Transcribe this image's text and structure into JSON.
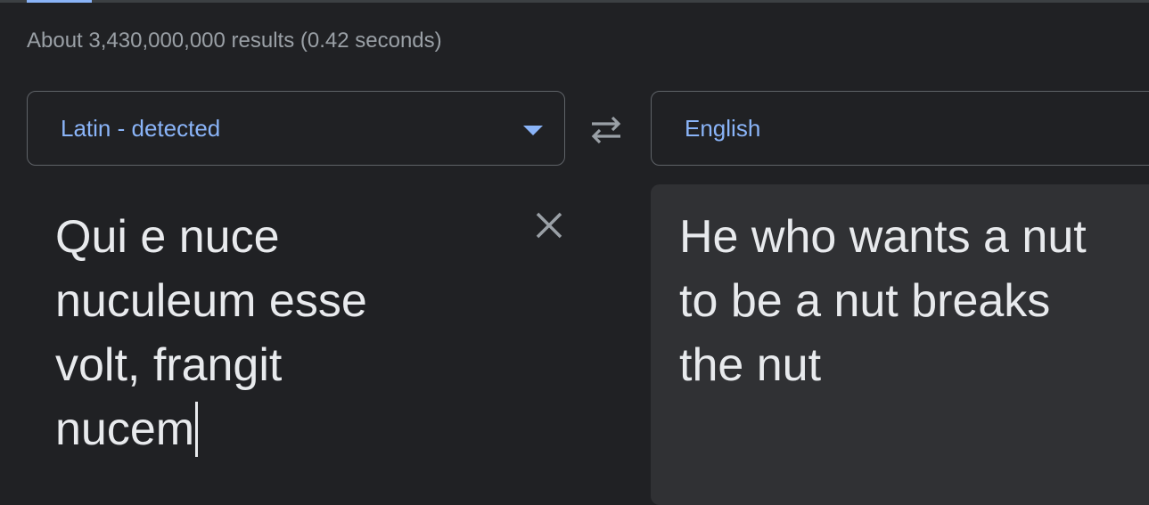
{
  "results_stats": "About 3,430,000,000 results (0.42 seconds)",
  "translator": {
    "source_language": "Latin - detected",
    "target_language": "English",
    "source_text": "Qui e nuce\nnuculeum esse\nvolt, frangit\nnucem",
    "translated_text": "He who wants a nut\nto be a nut breaks\nthe nut",
    "icons": {
      "swap": "swap-languages-icon",
      "clear": "close-icon",
      "dropdown": "chevron-down-icon"
    }
  },
  "colors": {
    "background": "#202124",
    "accent": "#8ab4f8",
    "text": "#e8eaed",
    "muted": "#9aa0a6",
    "panel": "#303134",
    "border": "#5f6368"
  }
}
